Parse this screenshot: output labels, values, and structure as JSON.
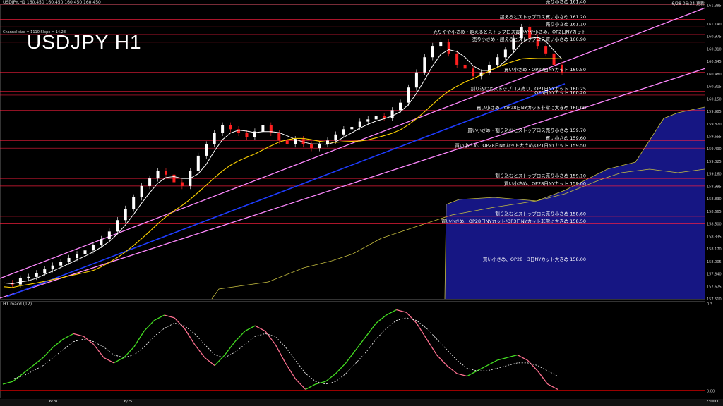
{
  "header": {
    "symbol_line": "USDJPY,H1  160.450 160.450 160.450 160.450",
    "timestamp": "6/28 06:34 更新",
    "channel_info": "Channel size = 1110  Slope = 14.28",
    "title": "USDJPY H1",
    "macd_label": "H1 macd (12)"
  },
  "bottom": {
    "tab1": "6/28",
    "tab2": "6/25",
    "right_value": "230000"
  },
  "chart_data": {
    "type": "line",
    "title": "USDJPY H1",
    "ylim": [
      157.51,
      161.4
    ],
    "y_ticks": [
      "161.385",
      "161.140",
      "160.975",
      "160.810",
      "160.645",
      "160.480",
      "160.315",
      "160.150",
      "159.985",
      "159.820",
      "159.655",
      "159.490",
      "159.325",
      "159.160",
      "158.995",
      "158.830",
      "158.665",
      "158.500",
      "158.335",
      "158.170",
      "158.005",
      "157.840",
      "157.675",
      "157.510"
    ],
    "price_series": [
      157.72,
      157.7,
      157.78,
      157.8,
      157.85,
      157.9,
      157.95,
      158.0,
      158.05,
      158.1,
      158.15,
      158.22,
      158.3,
      158.4,
      158.55,
      158.7,
      158.85,
      159.0,
      159.1,
      159.2,
      159.15,
      159.05,
      159.0,
      159.2,
      159.4,
      159.55,
      159.7,
      159.8,
      159.75,
      159.7,
      159.65,
      159.72,
      159.8,
      159.7,
      159.6,
      159.55,
      159.62,
      159.55,
      159.5,
      159.55,
      159.6,
      159.68,
      159.75,
      159.78,
      159.85,
      159.88,
      159.92,
      159.9,
      160.0,
      160.1,
      160.3,
      160.5,
      160.7,
      160.85,
      160.9,
      160.75,
      160.6,
      160.55,
      160.45,
      160.5,
      160.6,
      160.7,
      160.8,
      160.95,
      161.1,
      160.95,
      160.85,
      160.75,
      160.6,
      160.5
    ],
    "macd_series": [
      0.02,
      0.03,
      0.06,
      0.09,
      0.12,
      0.16,
      0.19,
      0.21,
      0.2,
      0.17,
      0.12,
      0.1,
      0.12,
      0.16,
      0.22,
      0.26,
      0.28,
      0.27,
      0.23,
      0.17,
      0.12,
      0.09,
      0.13,
      0.18,
      0.22,
      0.24,
      0.22,
      0.17,
      0.1,
      0.04,
      0.0,
      0.02,
      0.03,
      0.06,
      0.1,
      0.15,
      0.2,
      0.25,
      0.28,
      0.3,
      0.29,
      0.25,
      0.19,
      0.13,
      0.09,
      0.06,
      0.05,
      0.07,
      0.09,
      0.11,
      0.12,
      0.13,
      0.11,
      0.07,
      0.02,
      0.0
    ],
    "macd_signal_series": [
      0.04,
      0.04,
      0.05,
      0.07,
      0.09,
      0.12,
      0.15,
      0.18,
      0.19,
      0.18,
      0.16,
      0.13,
      0.12,
      0.13,
      0.16,
      0.2,
      0.23,
      0.25,
      0.24,
      0.21,
      0.17,
      0.13,
      0.12,
      0.14,
      0.17,
      0.2,
      0.21,
      0.2,
      0.16,
      0.11,
      0.06,
      0.03,
      0.02,
      0.03,
      0.06,
      0.1,
      0.14,
      0.19,
      0.23,
      0.26,
      0.27,
      0.26,
      0.23,
      0.19,
      0.15,
      0.11,
      0.08,
      0.07,
      0.07,
      0.08,
      0.09,
      0.1,
      0.1,
      0.09,
      0.07,
      0.05
    ],
    "macd_ticks": [
      "0.3",
      "0.00"
    ],
    "levels": [
      {
        "price": 161.4,
        "label": "売り小さめ 161.40"
      },
      {
        "price": 161.2,
        "label": "超えるとストップロス買い小さめ 161.20"
      },
      {
        "price": 161.1,
        "label": "売り小さめ 161.10"
      },
      {
        "price": 161.0,
        "label": "売りやや小さめ・超えるとストップロス買いやや小さめ、OP2日NYカット"
      },
      {
        "price": 160.9,
        "label": "売り小さめ・超えるとストップロス買い小さめ 160.90"
      },
      {
        "price": 160.5,
        "label": "買い小さめ・OP28日NYカット 160.50"
      },
      {
        "price": 160.25,
        "label": "割り込むとストップロス売り、OP1日NYカット 160.25"
      },
      {
        "price": 160.2,
        "label": "OP3日NYカット 160.20"
      },
      {
        "price": 160.0,
        "label": "買い小さめ、OP28日NYカット非常に大きめ 160.00"
      },
      {
        "price": 159.7,
        "label": "買い小さめ・割り込むとストップロス売り小さめ 159.70"
      },
      {
        "price": 159.6,
        "label": "買い小さめ 159.60"
      },
      {
        "price": 159.5,
        "label": "買い小さめ、OP28日NYカット大きめ/OP1日NYカット 159.50"
      },
      {
        "price": 159.1,
        "label": "割り込むとストップロス売り小さめ 159.10"
      },
      {
        "price": 159.0,
        "label": "買い小さめ、OP28日NYカット 159.00"
      },
      {
        "price": 158.6,
        "label": "割り込むとストップロス売り小さめ 158.60"
      },
      {
        "price": 158.5,
        "label": "買い小さめ、OP28日NYカット/OP3日NYカット非常に大きめ 158.50"
      },
      {
        "price": 158.0,
        "label": "買い小さめ、OP28・3日NYカット大きめ 158.00"
      }
    ],
    "colors": {
      "background": "#000000",
      "channel": "#ff88ff",
      "trend_blue": "#1e3cff",
      "ma_fast": "#ffffff",
      "ma_slow": "#ffd400",
      "ichimoku_cloud": "#1a1a9a",
      "level_line": "#ff2040",
      "macd": "#44dd22",
      "macd_down": "#ff7090",
      "signal": "#ffffff"
    }
  }
}
